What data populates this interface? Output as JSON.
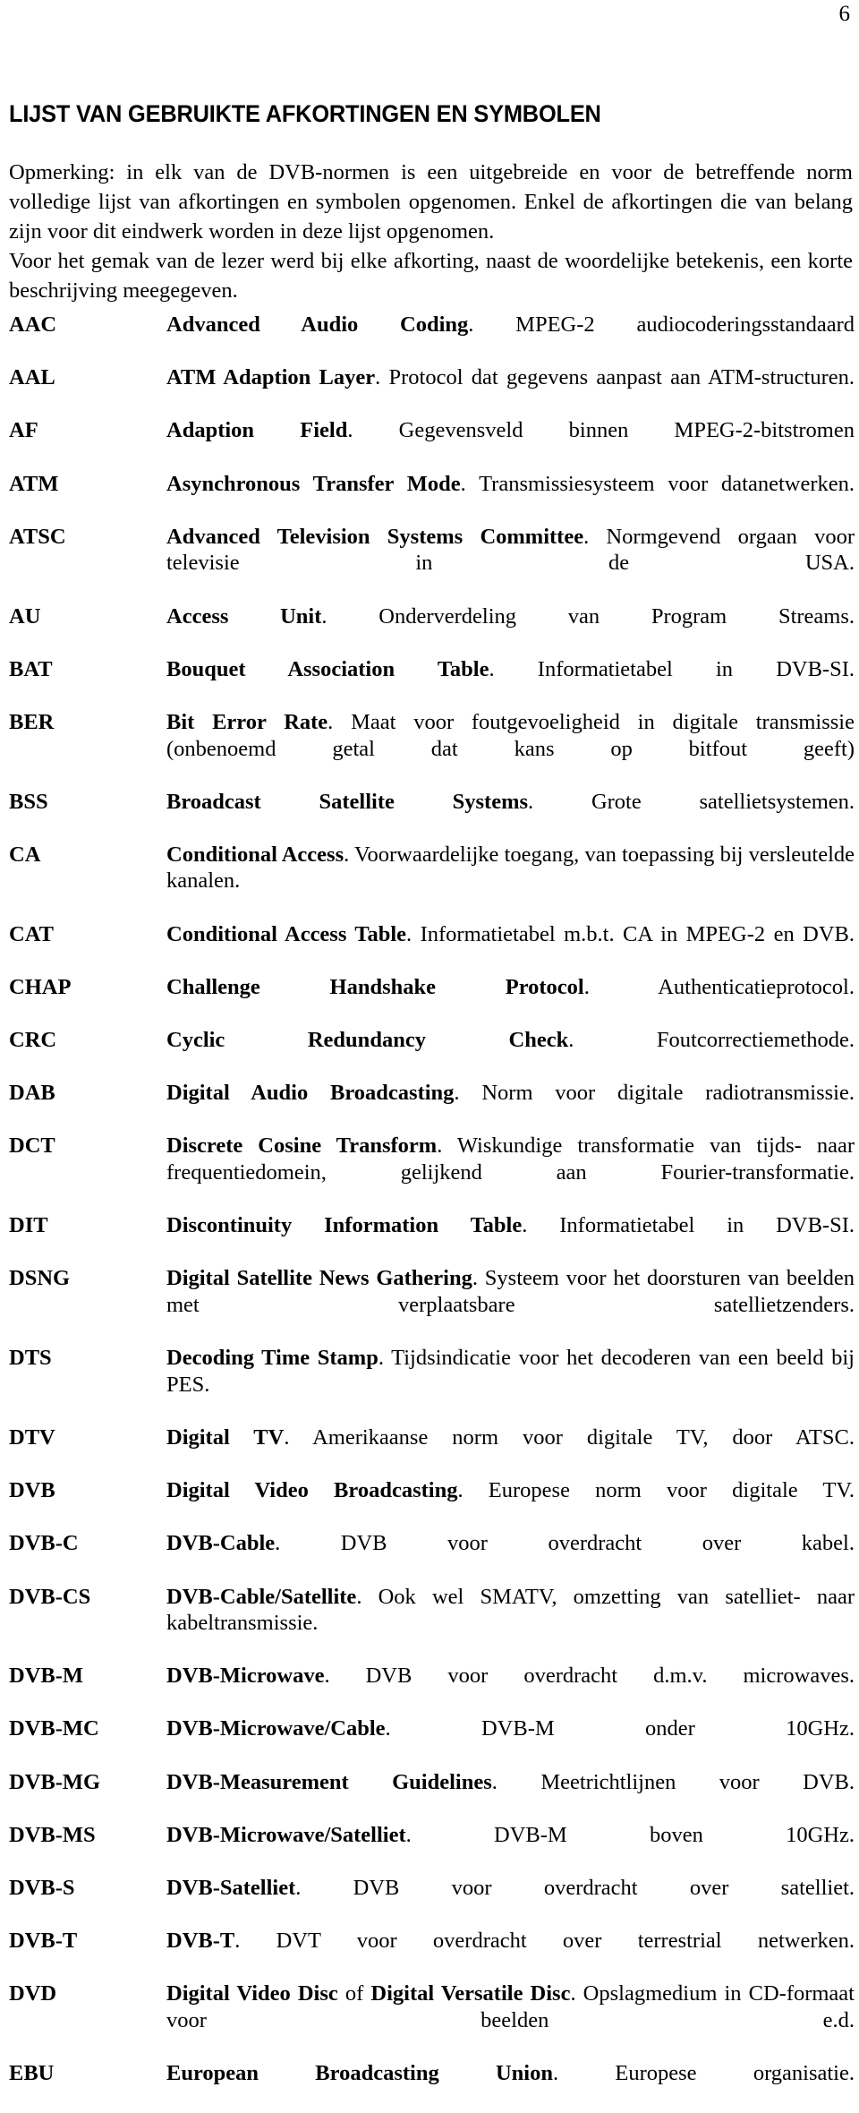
{
  "page": {
    "number": "6",
    "title": "LIJST VAN GEBRUIKTE AFKORTINGEN EN SYMBOLEN"
  },
  "intro": {
    "paragraph_1": "Opmerking: in elk van de DVB-normen is een uitgebreide en voor de betreffende norm volledige lijst van afkortingen en symbolen opgenomen.  Enkel de afkortingen die van belang zijn voor dit eindwerk worden in deze lijst opgenomen.",
    "paragraph_2": "Voor het gemak van de lezer werd bij elke afkorting, naast de woordelijke betekenis, een korte beschrijving meegegeven."
  },
  "abbreviations": [
    {
      "term": "AAC",
      "expansion": "Advanced Audio Coding",
      "description": ".  MPEG-2 audiocoderingsstandaard"
    },
    {
      "term": "AAL",
      "expansion": "ATM Adaption Layer",
      "description": ".   Protocol dat gegevens aanpast aan ATM-structuren."
    },
    {
      "term": "AF",
      "expansion": "Adaption Field",
      "description": ".  Gegevensveld binnen MPEG-2-bitstromen"
    },
    {
      "term": "ATM",
      "expansion": "Asynchronous Transfer Mode",
      "description": ".  Transmissiesysteem voor datanetwerken."
    },
    {
      "term": "ATSC",
      "expansion": "Advanced Television Systems Committee",
      "description": ".   Normgevend orgaan voor televisie in de USA."
    },
    {
      "term": "AU",
      "expansion": "Access Unit",
      "description": ".  Onderverdeling van Program Streams."
    },
    {
      "term": "BAT",
      "expansion": "Bouquet Association Table",
      "description": ".  Informatietabel in DVB-SI."
    },
    {
      "term": "BER",
      "expansion": "Bit Error Rate",
      "description": ".   Maat voor foutgevoeligheid in digitale transmissie (onbenoemd getal dat kans op bitfout geeft)"
    },
    {
      "term": "BSS",
      "expansion": "Broadcast Satellite Systems",
      "description": ".  Grote satellietsystemen."
    },
    {
      "term": "CA",
      "expansion": "Conditional Access",
      "description": ".   Voorwaardelijke toegang, van toepassing bij versleutelde kanalen."
    },
    {
      "term": "CAT",
      "expansion": "Conditional Access Table",
      "description": ".  Informatietabel m.b.t. CA in MPEG-2 en DVB."
    },
    {
      "term": "CHAP",
      "expansion": "Challenge Handshake Protocol",
      "description": ".  Authenticatieprotocol."
    },
    {
      "term": "CRC",
      "expansion": "Cyclic Redundancy Check",
      "description": ".  Foutcorrectiemethode."
    },
    {
      "term": "DAB",
      "expansion": "Digital Audio Broadcasting",
      "description": ".  Norm voor digitale radiotransmissie."
    },
    {
      "term": "DCT",
      "expansion": "Discrete Cosine Transform",
      "description": ".   Wiskundige transformatie van tijds- naar frequentiedomein, gelijkend aan Fourier-transformatie."
    },
    {
      "term": "DIT",
      "expansion": "Discontinuity Information Table",
      "description": ".  Informatietabel in DVB-SI."
    },
    {
      "term": "DSNG",
      "expansion": "Digital Satellite News Gathering",
      "description": ".   Systeem voor het doorsturen van beelden met verplaatsbare satellietzenders."
    },
    {
      "term": "DTS",
      "expansion": "Decoding Time Stamp",
      "description": ".   Tijdsindicatie voor het decoderen van een beeld bij PES."
    },
    {
      "term": "DTV",
      "expansion": "Digital TV",
      "description": ".  Amerikaanse norm voor digitale TV, door ATSC."
    },
    {
      "term": "DVB",
      "expansion": "Digital Video Broadcasting",
      "description": ".  Europese norm voor digitale TV."
    },
    {
      "term": "DVB-C",
      "expansion": "DVB-Cable",
      "description": ".  DVB voor overdracht over kabel."
    },
    {
      "term": "DVB-CS",
      "expansion": "DVB-Cable/Satellite",
      "description": ".   Ook wel SMATV, omzetting van satelliet- naar kabeltransmissie."
    },
    {
      "term": "DVB-M",
      "expansion": "DVB-Microwave",
      "description": ".  DVB voor overdracht d.m.v. microwaves."
    },
    {
      "term": "DVB-MC",
      "expansion": "DVB-Microwave/Cable",
      "description": ".  DVB-M onder 10GHz."
    },
    {
      "term": "DVB-MG",
      "expansion": "DVB-Measurement Guidelines",
      "description": ".  Meetrichtlijnen voor DVB."
    },
    {
      "term": "DVB-MS",
      "expansion": "DVB-Microwave/Satelliet",
      "description": ".  DVB-M boven 10GHz."
    },
    {
      "term": "DVB-S",
      "expansion": "DVB-Satelliet",
      "description": ".  DVB voor overdracht over satelliet."
    },
    {
      "term": "DVB-T",
      "expansion": "DVB-T",
      "description": ".  DVT voor overdracht over terrestrial netwerken."
    },
    {
      "term": "DVD",
      "expansion": "Digital Video Disc",
      "middle": " of ",
      "expansion_2": "Digital Versatile Disc",
      "description": ".   Opslagmedium in CD-formaat voor beelden e.d."
    },
    {
      "term": "EBU",
      "expansion": "European Broadcasting Union",
      "description": ".  Europese organisatie."
    }
  ]
}
